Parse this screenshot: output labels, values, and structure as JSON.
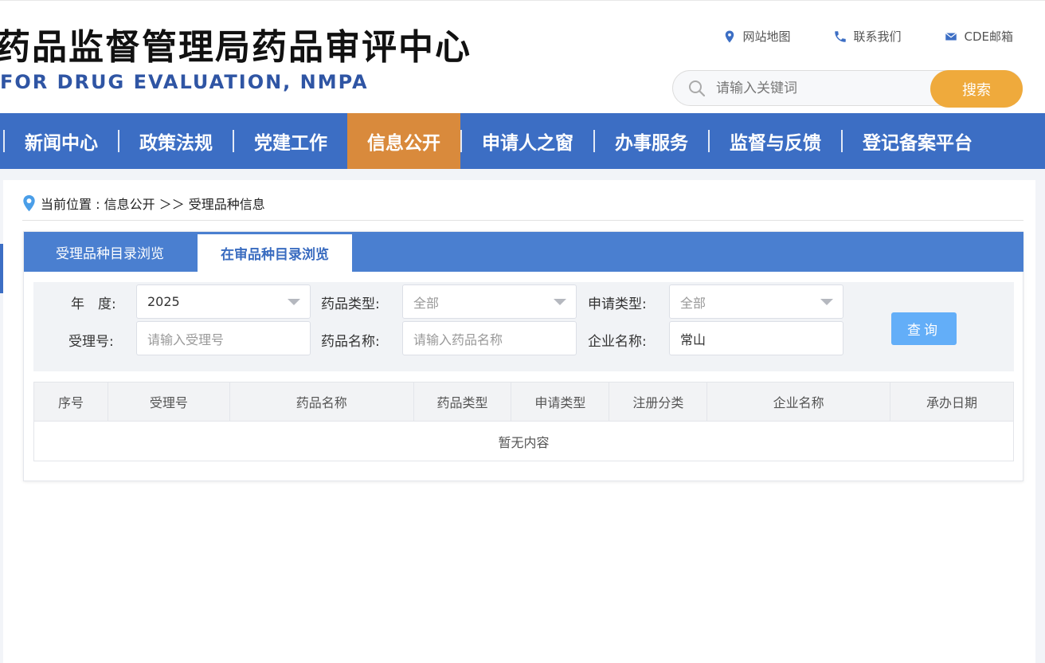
{
  "header": {
    "title": "药品监督管理局药品审评中心",
    "subtitle": "FOR DRUG EVALUATION, NMPA",
    "links": [
      {
        "label": "网站地图",
        "icon": "location-pin-icon"
      },
      {
        "label": "联系我们",
        "icon": "phone-icon"
      },
      {
        "label": "CDE邮箱",
        "icon": "mail-icon"
      }
    ],
    "search": {
      "placeholder": "请输入关键词",
      "button": "搜索"
    }
  },
  "nav": {
    "items": [
      {
        "label": "新闻中心"
      },
      {
        "label": "政策法规"
      },
      {
        "label": "党建工作"
      },
      {
        "label": "信息公开",
        "active": true
      },
      {
        "label": "申请人之窗"
      },
      {
        "label": "办事服务"
      },
      {
        "label": "监督与反馈"
      },
      {
        "label": "登记备案平台"
      }
    ]
  },
  "breadcrumb": {
    "prefix": "当前位置 : 信息公开 ＞＞ 受理品种信息"
  },
  "tabs": [
    {
      "label": "受理品种目录浏览"
    },
    {
      "label": "在审品种目录浏览",
      "active": true
    }
  ],
  "filters": {
    "year_label": "年　度:",
    "year_value": "2025",
    "drug_type_label": "药品类型:",
    "drug_type_value": "全部",
    "apply_type_label": "申请类型:",
    "apply_type_value": "全部",
    "accept_no_label": "受理号:",
    "accept_no_placeholder": "请输入受理号",
    "drug_name_label": "药品名称:",
    "drug_name_placeholder": "请输入药品名称",
    "company_label": "企业名称:",
    "company_value": "常山",
    "query_button": "查询"
  },
  "table": {
    "columns": [
      "序号",
      "受理号",
      "药品名称",
      "药品类型",
      "申请类型",
      "注册分类",
      "企业名称",
      "承办日期"
    ],
    "empty_text": "暂无内容"
  },
  "colors": {
    "nav_bg": "#3c6ec4",
    "nav_active": "#d98a3c",
    "search_button": "#efaa3c",
    "query_button": "#63aef8",
    "tab_bar": "#4a7fd0",
    "subtitle": "#2f55a4"
  }
}
